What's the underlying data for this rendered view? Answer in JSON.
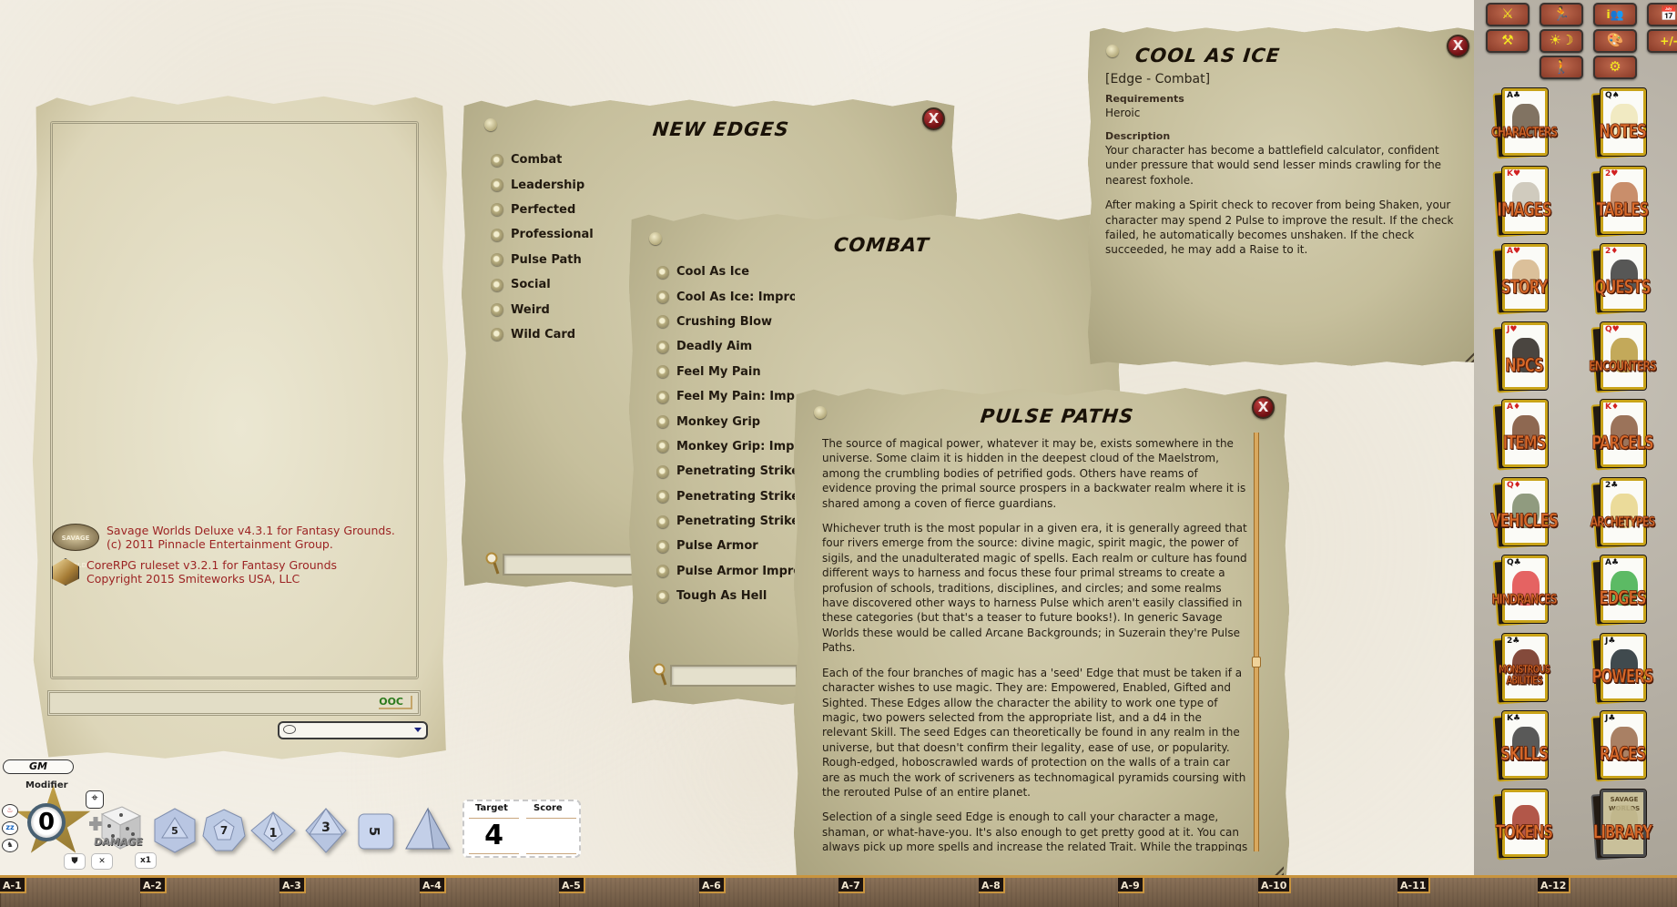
{
  "chat": {
    "messages": [
      {
        "line1": "Savage Worlds Deluxe v4.3.1 for Fantasy Grounds.",
        "line2": "(c) 2011 Pinnacle Entertainment Group.",
        "logo": "savage-worlds-logo"
      },
      {
        "line1": "CoreRPG ruleset v3.2.1 for Fantasy Grounds",
        "line2": "Copyright 2015 Smiteworks USA, LLC",
        "logo": "corerpg-logo"
      }
    ],
    "sw_logo_text": "SAVAGE WORLDS",
    "ooc_label": "OOC",
    "entry_value": "",
    "mode_select_value": ""
  },
  "controls": {
    "gm_label": "GM",
    "modifier_label": "Modifier",
    "modifier_value": "0",
    "side_icons": [
      "bleed-icon",
      "sleep-icon",
      "mount-icon"
    ],
    "side_icon_glyphs": [
      "♨",
      "zz",
      "♞"
    ],
    "damage_label": "DAMAGE",
    "multiplier_label": "x1",
    "dice": [
      "d20",
      "d12",
      "d10",
      "d8",
      "d6",
      "d4"
    ],
    "dice_faces": [
      "5",
      "7",
      "1",
      "3",
      "5",
      ""
    ],
    "target_label": "Target",
    "target_value": "4",
    "score_label": "Score",
    "score_value": ""
  },
  "grid_labels": [
    "A-1",
    "A-2",
    "A-3",
    "A-4",
    "A-5",
    "A-6",
    "A-7",
    "A-8",
    "A-9",
    "A-10",
    "A-11",
    "A-12"
  ],
  "windows": {
    "new_edges": {
      "title": "New Edges",
      "items": [
        "Combat",
        "Leadership",
        "Perfected",
        "Professional",
        "Pulse Path",
        "Social",
        "Weird",
        "Wild Card"
      ],
      "filter_value": ""
    },
    "combat": {
      "title": "Combat",
      "items": [
        "Cool As Ice",
        "Cool As Ice: Improved",
        "Crushing Blow",
        "Deadly Aim",
        "Feel My Pain",
        "Feel My Pain: Improved",
        "Monkey Grip",
        "Monkey Grip: Improved",
        "Penetrating Strike",
        "Penetrating Strike: Improved",
        "Penetrating Strike: Master",
        "Pulse Armor",
        "Pulse Armor Improved",
        "Tough As Hell"
      ],
      "filter_value": ""
    },
    "cool_as_ice": {
      "title": "Cool As Ice",
      "type": "[Edge - Combat]",
      "requirements_label": "Requirements",
      "requirements": "Heroic",
      "description_label": "Description",
      "description": [
        "Your character has become a battlefield calculator, confident under pressure that would send lesser minds crawling for the nearest foxhole.",
        "After making a Spirit check to recover from being Shaken, your character may spend 2 Pulse to improve the result. If the check failed, he automatically becomes unshaken. If the check succeeded, he may add a Raise to it."
      ]
    },
    "pulse_paths": {
      "title": "Pulse Paths",
      "paragraphs": [
        "The source of magical power, whatever it may be, exists somewhere in the universe. Some claim it is hidden in the deepest cloud of the Maelstrom, among the crumbling bodies of petrified gods. Others have reams of evidence proving the primal source prospers in a backwater realm where it is shared among a coven of fierce guardians.",
        "Whichever truth is the most popular in a given era, it is generally agreed that four rivers emerge from the source: divine magic, spirit magic, the power of sigils, and the unadulterated magic of spells. Each realm or culture has found different ways to harness and focus these four primal streams to create a profusion of schools, traditions, disciplines, and circles; and some realms have discovered other ways to harness Pulse which aren't easily classified in these categories (but that's a teaser to future books!). In generic Savage Worlds these would be called Arcane Backgrounds; in Suzerain they're Pulse Paths.",
        "Each of the four branches of magic has a 'seed' Edge that must be taken if a character wishes to use magic. They are: Empowered, Enabled, Gifted and Sighted. These Edges allow the character the ability to work one type of magic, two powers selected from the appropriate list, and a d4 in the relevant Skill. The seed Edges can theoretically be found in any realm in the universe, but that doesn't confirm their legality, ease of use, or popularity. Rough-edged, hoboscrawled wards of protection on the walls of a train car are as much the work of scriveners as technomagical pyramids coursing with the rerouted Pulse of an entire planet.",
        "Selection of a single seed Edge is enough to call your character a mage, shaman, or what-have-you. It's also enough to get pretty good at it. You can always pick up more spells and increase the related Trait. While the trappings"
      ],
      "scroll_position": 0.55
    },
    "close_glyph": "X"
  },
  "sidebar": {
    "tool_buttons": [
      {
        "name": "combat-tracker-button",
        "icon": "crossed-swords-icon",
        "glyph": "⚔"
      },
      {
        "name": "party-sheet-button",
        "icon": "running-figures-icon",
        "glyph": "🏃"
      },
      {
        "name": "party-info-button",
        "icon": "info-party-icon",
        "glyph": "i👥"
      },
      {
        "name": "calendar-button",
        "icon": "calendar-icon",
        "glyph": "📅"
      },
      {
        "name": "tools-button",
        "icon": "hammer-wrench-icon",
        "glyph": "⚒"
      },
      {
        "name": "lighting-button",
        "icon": "sun-moon-icon",
        "glyph": "☀☽"
      },
      {
        "name": "colors-button",
        "icon": "palette-icon",
        "glyph": "🎨"
      },
      {
        "name": "modifiers-button",
        "icon": "plus-minus-icon",
        "glyph": "+/-"
      },
      {
        "name": "identity-button",
        "icon": "person-icon",
        "glyph": "🚶"
      },
      {
        "name": "options-button",
        "icon": "gear-icon",
        "glyph": "⚙"
      }
    ],
    "library": [
      {
        "label": "Characters",
        "rank": "A♣",
        "suit_color": "#111111",
        "pic": "#6b5a48"
      },
      {
        "label": "Notes",
        "rank": "Q♠",
        "suit_color": "#111111",
        "pic": "#efe6b8"
      },
      {
        "label": "Images",
        "rank": "K♥",
        "suit_color": "#d12020",
        "pic": "#c8c2b4"
      },
      {
        "label": "Tables",
        "rank": "2♥",
        "suit_color": "#d12020",
        "pic": "#c07a52"
      },
      {
        "label": "Story",
        "rank": "A♥",
        "suit_color": "#d12020",
        "pic": "#d5b58a"
      },
      {
        "label": "Quests",
        "rank": "2♦",
        "suit_color": "#d12020",
        "pic": "#3a3a3a"
      },
      {
        "label": "NPCs",
        "rank": "J♥",
        "suit_color": "#d12020",
        "pic": "#2a2420"
      },
      {
        "label": "Encounters",
        "rank": "Q♥",
        "suit_color": "#d12020",
        "pic": "#b89a3e"
      },
      {
        "label": "Items",
        "rank": "A♦",
        "suit_color": "#d12020",
        "pic": "#7a4e34"
      },
      {
        "label": "Parcels",
        "rank": "K♦",
        "suit_color": "#d12020",
        "pic": "#8a5a3e"
      },
      {
        "label": "Vehicles",
        "rank": "Q♦",
        "suit_color": "#d12020",
        "pic": "#7c8a6a"
      },
      {
        "label": "Archetypes",
        "rank": "2♣",
        "suit_color": "#111111",
        "pic": "#e7d58a"
      },
      {
        "label": "Hindrances",
        "rank": "Q♣",
        "suit_color": "#111111",
        "pic": "#e04848"
      },
      {
        "label": "Edges",
        "rank": "A♣",
        "suit_color": "#111111",
        "pic": "#3fae4a"
      },
      {
        "label": "Monstrous Abilities",
        "rank": "2♣",
        "suit_color": "#111111",
        "pic": "#6e2a1a"
      },
      {
        "label": "Powers",
        "rank": "J♣",
        "suit_color": "#111111",
        "pic": "#1e2a30"
      },
      {
        "label": "Skills",
        "rank": "K♣",
        "suit_color": "#111111",
        "pic": "#3c3c3c"
      },
      {
        "label": "Races",
        "rank": "J♣",
        "suit_color": "#111111",
        "pic": "#9a6a4a"
      },
      {
        "label": "Tokens",
        "rank": "",
        "suit_color": "#111111",
        "pic": "#a43a2a"
      },
      {
        "label": "Library",
        "rank": "SAVAGE WORLDS",
        "suit_color": "#5a4a2a",
        "pic": "#bfb58a"
      }
    ]
  }
}
